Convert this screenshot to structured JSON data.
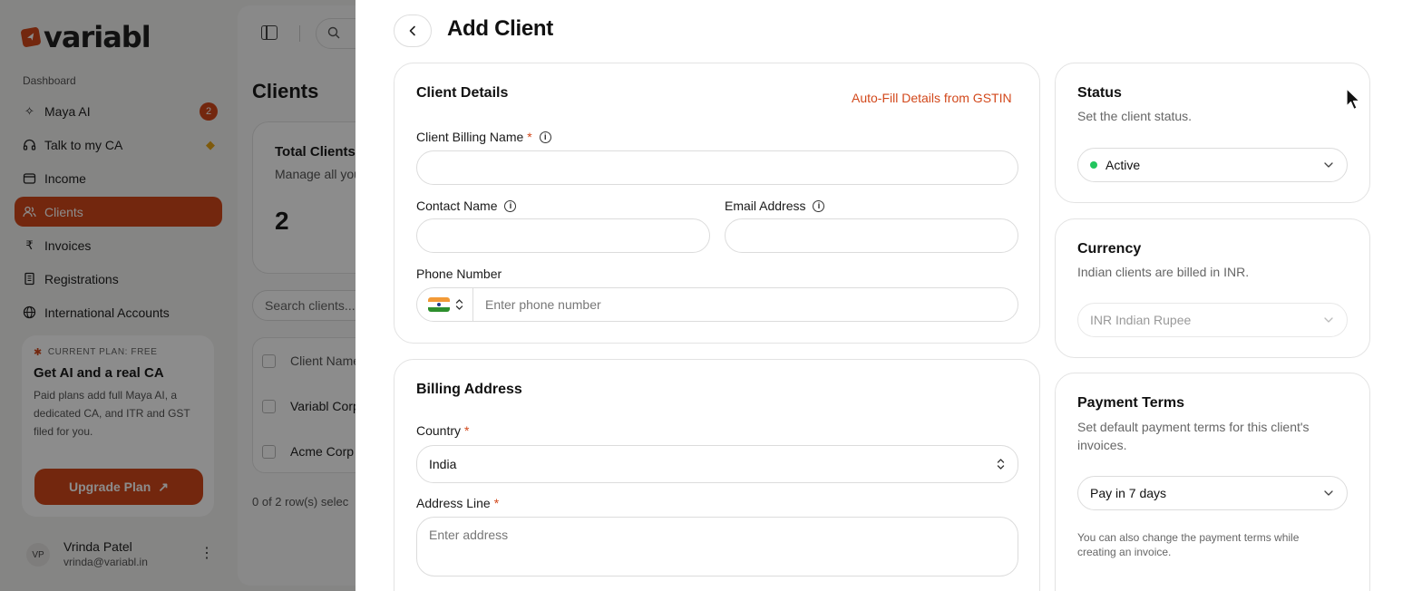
{
  "background": {
    "logo_text": "variabl",
    "section_label": "Dashboard",
    "nav": [
      {
        "label": "Maya AI",
        "icon": "sparkle-icon",
        "badge": "2"
      },
      {
        "label": "Talk to my CA",
        "icon": "headphones-icon",
        "extra": "gem-icon"
      },
      {
        "label": "Income",
        "icon": "wallet-icon"
      },
      {
        "label": "Clients",
        "icon": "users-icon",
        "active": true
      },
      {
        "label": "Invoices",
        "icon": "rupee-icon"
      },
      {
        "label": "Registrations",
        "icon": "building-icon"
      },
      {
        "label": "International Accounts",
        "icon": "globe-icon"
      }
    ],
    "plan": {
      "tag": "CURRENT PLAN: FREE",
      "title": "Get AI and a real CA",
      "description": "Paid plans add full Maya AI, a dedicated CA, and ITR and GST filed for you.",
      "button": "Upgrade Plan"
    },
    "user": {
      "initials": "VP",
      "name": "Vrinda Patel",
      "email": "vrinda@variabl.in"
    },
    "page_title": "Clients",
    "stat": {
      "title": "Total Clients",
      "subtitle": "Manage all you",
      "value": "2"
    },
    "search_placeholder": "Search clients...",
    "table": {
      "header": "Client Name",
      "rows": [
        "Variabl Corp",
        "Acme Corp"
      ]
    },
    "row_count": "0 of 2 row(s) selec"
  },
  "sheet": {
    "title": "Add Client",
    "client_details": {
      "title": "Client Details",
      "autofill_link": "Auto-Fill Details from GSTIN",
      "billing_name_label": "Client Billing Name",
      "contact_name_label": "Contact Name",
      "email_label": "Email Address",
      "phone_label": "Phone Number",
      "phone_placeholder": "Enter phone number"
    },
    "billing_address": {
      "title": "Billing Address",
      "country_label": "Country",
      "country_value": "India",
      "address_label": "Address Line",
      "address_placeholder": "Enter address"
    },
    "status": {
      "title": "Status",
      "description": "Set the client status.",
      "value": "Active",
      "dot_color": "#22c55e"
    },
    "currency": {
      "title": "Currency",
      "description": "Indian clients are billed in INR.",
      "value": "INR Indian Rupee"
    },
    "payment_terms": {
      "title": "Payment Terms",
      "description": "Set default payment terms for this client's invoices.",
      "value": "Pay in 7 days",
      "note": "You can also change the payment terms while creating an invoice."
    },
    "required_marker": "*",
    "info_marker": "i"
  },
  "colors": {
    "accent": "#d2481b",
    "overlay": "rgba(0,0,0,0.45)"
  }
}
